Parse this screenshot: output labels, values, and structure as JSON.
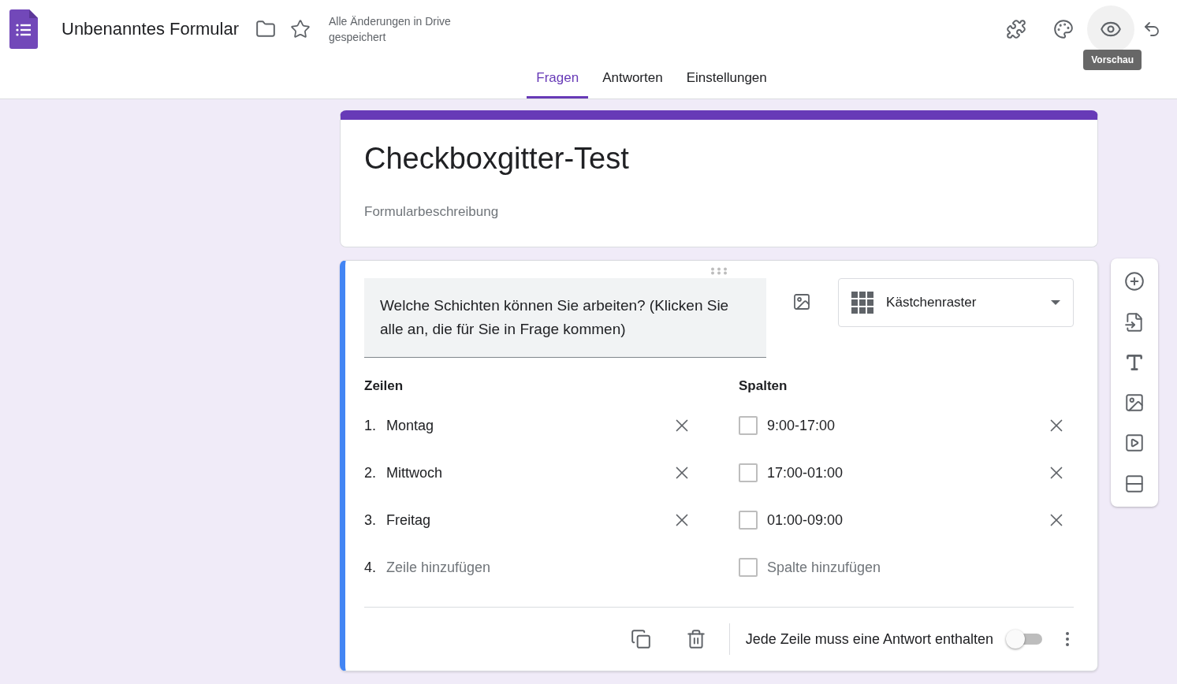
{
  "header": {
    "title": "Unbenanntes Formular",
    "save_status": "Alle Änderungen in Drive gespeichert",
    "tooltip": "Vorschau"
  },
  "tabs": [
    {
      "label": "Fragen",
      "selected": true
    },
    {
      "label": "Antworten",
      "selected": false
    },
    {
      "label": "Einstellungen",
      "selected": false
    }
  ],
  "form": {
    "title": "Checkboxgitter-Test",
    "description_placeholder": "Formularbeschreibung"
  },
  "question": {
    "text": "Welche Schichten können Sie arbeiten? (Klicken Sie alle an, die für Sie in Frage kommen)",
    "type": "Kästchenraster",
    "rows_heading": "Zeilen",
    "columns_heading": "Spalten",
    "rows": [
      {
        "number": "1.",
        "label": "Montag",
        "kind": "option"
      },
      {
        "number": "2.",
        "label": "Mittwoch",
        "kind": "option"
      },
      {
        "number": "3.",
        "label": "Freitag",
        "kind": "option"
      },
      {
        "number": "4.",
        "label": "Zeile hinzufügen",
        "kind": "add"
      }
    ],
    "columns": [
      {
        "label": "9:00-17:00",
        "kind": "option"
      },
      {
        "label": "17:00-01:00",
        "kind": "option"
      },
      {
        "label": "01:00-09:00",
        "kind": "option"
      },
      {
        "label": "Spalte hinzufügen",
        "kind": "add"
      }
    ],
    "required_label": "Jede Zeile muss eine Antwort enthalten",
    "required": {
      "on": false
    }
  }
}
